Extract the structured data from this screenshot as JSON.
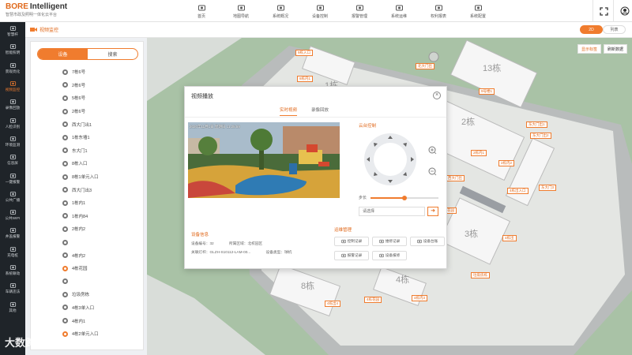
{
  "brand": {
    "name1": "BORE",
    "name2": "Intelligent",
    "subtitle": "智慧市政及照明一体化云平台"
  },
  "nav": [
    {
      "label": "首页",
      "icon": "home-icon"
    },
    {
      "label": "地图导航",
      "icon": "map-icon"
    },
    {
      "label": "系统概况",
      "icon": "overview-icon"
    },
    {
      "label": "设备控制",
      "icon": "device-icon"
    },
    {
      "label": "报警管理",
      "icon": "alarm-icon"
    },
    {
      "label": "系统运维",
      "icon": "maintenance-icon"
    },
    {
      "label": "权利报表",
      "icon": "report-icon"
    },
    {
      "label": "系统配置",
      "icon": "settings-icon"
    }
  ],
  "sidebar": [
    {
      "label": "智慧杆",
      "icon": "pole-icon"
    },
    {
      "label": "智能照明",
      "icon": "lamp-icon"
    },
    {
      "label": "景观亮化",
      "icon": "moon-icon"
    },
    {
      "label": "视频监控",
      "icon": "camera-icon",
      "active": true
    },
    {
      "label": "录像回放",
      "icon": "playback-icon"
    },
    {
      "label": "人脸识别",
      "icon": "face-icon"
    },
    {
      "label": "环境监测",
      "icon": "environment-icon"
    },
    {
      "label": "信息屏",
      "icon": "screen-icon"
    },
    {
      "label": "一键报警",
      "icon": "bell-icon"
    },
    {
      "label": "公共广播",
      "icon": "broadcast-icon"
    },
    {
      "label": "公共WIFI",
      "icon": "wifi-icon"
    },
    {
      "label": "井盖报警",
      "icon": "manhole-icon"
    },
    {
      "label": "充电桩",
      "icon": "charger-icon"
    },
    {
      "label": "系统联动",
      "icon": "link-icon"
    },
    {
      "label": "车辆违法",
      "icon": "car-icon"
    },
    {
      "label": "其他",
      "icon": "more-icon"
    }
  ],
  "breadcrumb": "视频监控",
  "view_toggle": {
    "on": "2D",
    "off": "列表"
  },
  "left_tabs": {
    "active": "设备",
    "other": "搜索"
  },
  "list": [
    {
      "label": "7栋6号",
      "orange": false
    },
    {
      "label": "2栋6号",
      "orange": false
    },
    {
      "label": "5栋6号",
      "orange": false
    },
    {
      "label": "2栋6号",
      "orange": false
    },
    {
      "label": "西大门出1",
      "orange": false
    },
    {
      "label": "1栋东墙1",
      "orange": false
    },
    {
      "label": "东大门1",
      "orange": false
    },
    {
      "label": "8栋入口",
      "orange": false
    },
    {
      "label": "8栋1单元入口",
      "orange": false
    },
    {
      "label": "西大门出3",
      "orange": false
    },
    {
      "label": "1栋内1",
      "orange": false
    },
    {
      "label": "1栋内84",
      "orange": false
    },
    {
      "label": "2栋内2",
      "orange": false
    },
    {
      "label": "",
      "orange": false
    },
    {
      "label": "4栋内2",
      "orange": false
    },
    {
      "label": "4栋花园",
      "orange": true
    },
    {
      "label": "",
      "orange": false
    },
    {
      "label": "垃圾房栋",
      "orange": false
    },
    {
      "label": "4栋3单入口",
      "orange": false
    },
    {
      "label": "4栋内1",
      "orange": false
    },
    {
      "label": "4栋2单元入口",
      "orange": true
    }
  ],
  "map_buttons": {
    "show_tags": "显示标签",
    "refresh": "刷新数据"
  },
  "map_buildings": [
    "1栋",
    "13栋",
    "2栋",
    "3栋",
    "4栋",
    "8栋"
  ],
  "map_pins": [
    "9栋入口",
    "北大门出",
    "8栋内1",
    "8栋内2",
    "9号楼1",
    "3栋花园",
    "东大门出1",
    "东大门出2",
    "2栋内1",
    "2栋内2",
    "西大门出",
    "4栋出入口",
    "东大门3",
    "地下花园",
    "4栋出",
    "垃圾房栋",
    "4栋出4",
    "4栋花园",
    "4栋内3"
  ],
  "modal": {
    "title": "视频播放",
    "close": "×",
    "tab_live": "实时视频",
    "tab_playback": "录像回放",
    "timestamp": "2020年11月1日  星期日  11:25:59",
    "ptz_title": "云台控制",
    "zoom_label": "步长",
    "zoom_level": 0.5,
    "select_placeholder": "请选择",
    "go": "➜",
    "info_title": "设备信息",
    "device_number_label": "设备编号：",
    "device_number": "32",
    "area_label": "所属区域：",
    "area": "北校园区",
    "address_label": "关联灯杆：",
    "address": "GLZH-S10112-LAM-00...",
    "device_type_label": "设备类型：",
    "device_type": "球机",
    "mgmt_title": "运维管理",
    "buttons": [
      {
        "label": "控制记录",
        "icon": "control-log-icon"
      },
      {
        "label": "维修记录",
        "icon": "repair-log-icon"
      },
      {
        "label": "设备台账",
        "icon": "ledger-icon"
      },
      {
        "label": "报警记录",
        "icon": "alarm-log-icon"
      },
      {
        "label": "设备报修",
        "icon": "report-repair-icon"
      }
    ]
  },
  "watermark": "大数跨境"
}
